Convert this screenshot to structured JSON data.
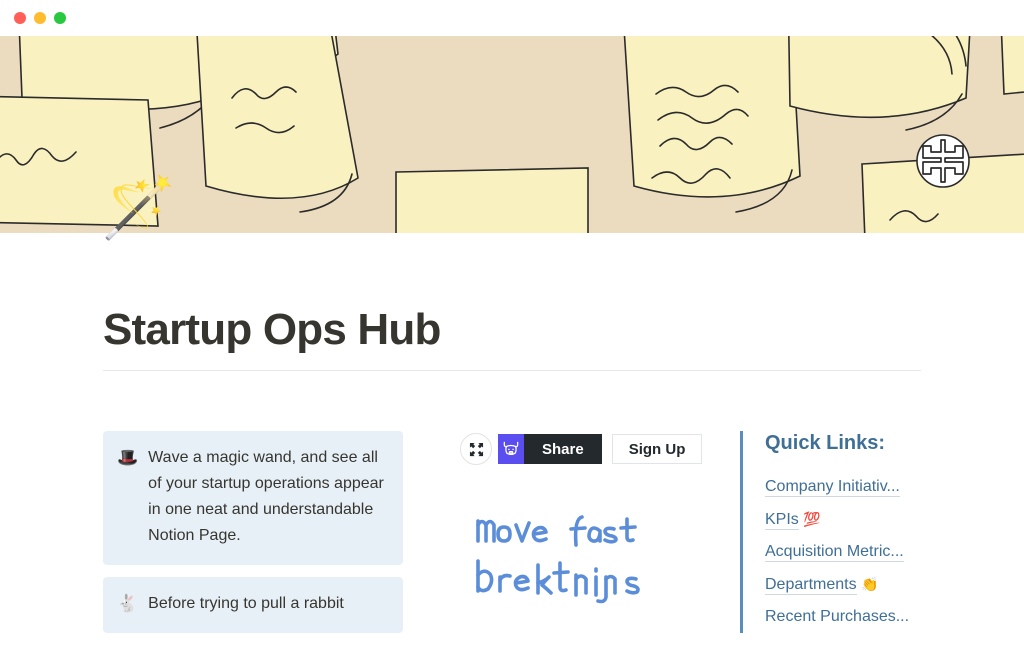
{
  "window": {
    "traffic_lights": [
      {
        "name": "close",
        "color": "#ff5f57"
      },
      {
        "name": "minimize",
        "color": "#febc2e"
      },
      {
        "name": "maximize",
        "color": "#28c840"
      }
    ]
  },
  "cover": {
    "alt": "illustration of hand-drawn sticky notes and papers",
    "background_color": "#ecdcbf",
    "note_color": "#faf1c0",
    "ink_color": "#2b2b2b",
    "badge_icon": "pinwheel-badge-icon"
  },
  "page": {
    "icon": "magic-wand-emoji",
    "icon_glyph": "🪄",
    "title": "Startup Ops Hub"
  },
  "callouts": [
    {
      "emoji": "🎩",
      "emoji_name": "top-hat-emoji",
      "text": "Wave a magic wand, and see all of your startup operations appear in one neat and understandable Notion Page."
    },
    {
      "emoji": "🐇",
      "emoji_name": "rabbit-emoji",
      "text": "Before trying to pull a rabbit"
    }
  ],
  "embed": {
    "expand_icon": "expand-icon",
    "brand_logo": "bull-head-logo-icon",
    "brand_color": "#5b4ef0",
    "share_label": "Share",
    "signup_label": "Sign Up",
    "handwriting_line1": "move fast",
    "handwriting_line2": "break things",
    "handwriting_color": "#5b8dd9"
  },
  "quick_links": {
    "accent_color": "#5a8fbc",
    "title": "Quick Links:",
    "items": [
      {
        "label": "Company Initiativ...",
        "emoji": ""
      },
      {
        "label": "KPIs",
        "emoji": "💯"
      },
      {
        "label": "Acquisition Metric...",
        "emoji": ""
      },
      {
        "label": "Departments",
        "emoji": "👏"
      },
      {
        "label": "Recent Purchases...",
        "emoji": ""
      }
    ]
  }
}
